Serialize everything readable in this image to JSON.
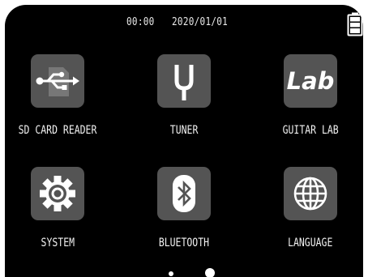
{
  "status": {
    "time": "00:00",
    "date": "2020/01/01",
    "battery_icon": "battery-full-icon"
  },
  "menu": {
    "items": [
      {
        "label": "SD CARD READER",
        "icon": "usb-icon"
      },
      {
        "label": "TUNER",
        "icon": "tuning-fork-icon"
      },
      {
        "label": "GUITAR LAB",
        "icon": "lab-icon",
        "icon_text": "Lab"
      },
      {
        "label": "SYSTEM",
        "icon": "gear-icon"
      },
      {
        "label": "BLUETOOTH",
        "icon": "bluetooth-icon"
      },
      {
        "label": "LANGUAGE",
        "icon": "globe-icon"
      }
    ]
  },
  "pagination": {
    "pages": 2,
    "current": 2
  },
  "colors": {
    "screen_background": "#000000",
    "tile_background": "#545454",
    "icon_foreground": "#ffffff",
    "text": "#f2f2f2"
  }
}
